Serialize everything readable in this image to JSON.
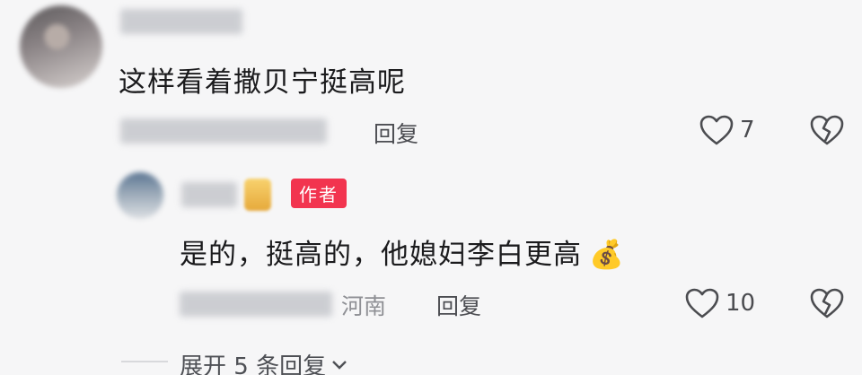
{
  "comment": {
    "text": "这样看着撒贝宁挺高呢",
    "reply_label": "回复",
    "likes": "7"
  },
  "author_reply": {
    "author_badge": "作者",
    "text": "是的，挺高的，他媳妇李白更高",
    "emoji": "💰",
    "location": "河南",
    "reply_label": "回复",
    "likes": "10"
  },
  "expand": {
    "label": "展开 5 条回复"
  },
  "colors": {
    "badge": "#f2344f",
    "background": "#f6f6f7"
  }
}
